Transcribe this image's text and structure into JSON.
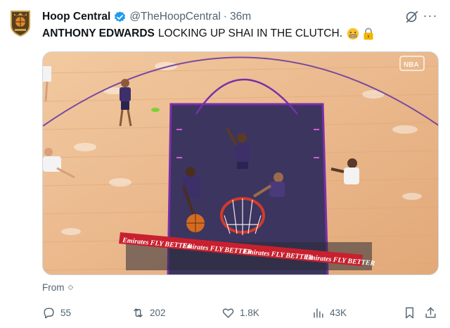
{
  "account": {
    "display_name": "Hoop Central",
    "handle": "@TheHoopCentral",
    "separator": "·",
    "time": "36m",
    "verified": true
  },
  "tweet": {
    "text_bold": "ANTHONY EDWARDS",
    "text_rest": "LOCKING UP SHAI IN THE CLUTCH.",
    "emojis": [
      "grimacing-hot-face-emoji",
      "lock-emoji"
    ]
  },
  "media": {
    "type": "video-frame",
    "description_icons": [
      "basketball-court",
      "hoop",
      "players"
    ],
    "ad_board_text": "Emirates FLY BETTER",
    "watermark": "NBA"
  },
  "from": {
    "label": "From"
  },
  "actions": {
    "replies": "55",
    "reposts": "202",
    "likes": "1.8K",
    "views": "43K"
  },
  "colors": {
    "text": "#0f1419",
    "secondary": "#536471",
    "verified": "#1d9bf0",
    "court_paint": "#3b3560",
    "court_wood": "#e9b88d"
  }
}
